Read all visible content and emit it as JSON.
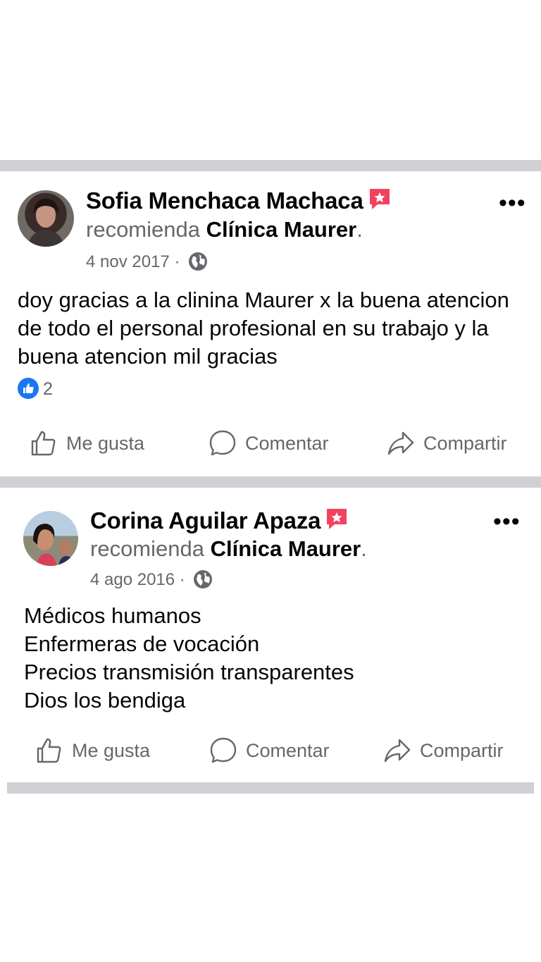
{
  "posts": [
    {
      "author": "Sofia Menchaca Machaca",
      "action_text": "recomienda",
      "page": "Clínica Maurer",
      "date": "4 nov 2017",
      "date_sep": "·",
      "more": "•••",
      "body": "doy gracias a la clinina Maurer x la buena atencion de todo el personal profesional en su trabajo y la buena atencion mil gracias",
      "like_count": "2",
      "actions": {
        "like": "Me gusta",
        "comment": "Comentar",
        "share": "Compartir"
      }
    },
    {
      "author": "Corina Aguilar Apaza",
      "action_text": "recomienda",
      "page": "Clínica Maurer",
      "date": "4 ago 2016",
      "date_sep": "·",
      "more": "•••",
      "body_lines": [
        "Médicos humanos",
        "Enfermeras de vocación",
        "Precios transmisión transparentes",
        "Dios los bendiga"
      ],
      "actions": {
        "like": "Me gusta",
        "comment": "Comentar",
        "share": "Compartir"
      }
    }
  ],
  "colors": {
    "recommend_badge": "#f3425f",
    "like_blue": "#1877f2",
    "divider": "#ced0d4",
    "secondary_text": "#65676b"
  }
}
